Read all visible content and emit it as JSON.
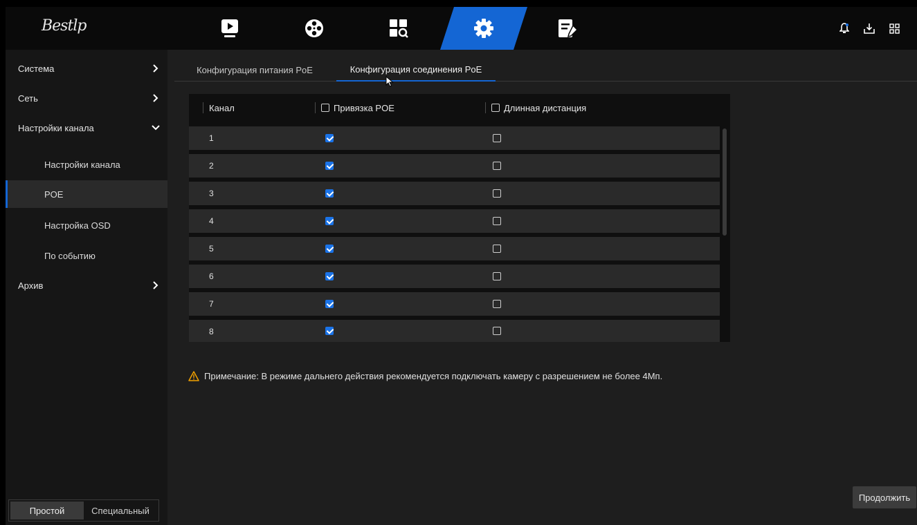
{
  "app": {
    "logo_text": "Bestlp"
  },
  "topnav": {
    "items": [
      {
        "name": "playback",
        "icon": "playback-icon"
      },
      {
        "name": "ai",
        "icon": "film-reel-icon"
      },
      {
        "name": "search",
        "icon": "search-image-icon"
      },
      {
        "name": "settings",
        "icon": "gear-icon",
        "active": true
      },
      {
        "name": "maintenance",
        "icon": "maintenance-icon"
      }
    ],
    "right_icons": [
      "alarm-bell-icon",
      "download-icon",
      "grid-icon"
    ]
  },
  "sidebar": {
    "items": [
      {
        "label": "Система",
        "arrow": "right"
      },
      {
        "label": "Сеть",
        "arrow": "right"
      },
      {
        "label": "Настройки канала",
        "arrow": "down"
      },
      {
        "label": "Настройки канала",
        "sub": true
      },
      {
        "label": "POE",
        "sub": true,
        "active": true
      },
      {
        "label": "Настройка OSD",
        "sub": true
      },
      {
        "label": "По событию",
        "sub": true
      },
      {
        "label": "Архив",
        "arrow": "right"
      }
    ],
    "mode": {
      "simple": "Простой",
      "special": "Специальный",
      "selected": "simple"
    }
  },
  "tabs": [
    {
      "label": "Конфигурация питания PoE",
      "active": false
    },
    {
      "label": "Конфигурация соединения PoE",
      "active": true
    }
  ],
  "table": {
    "headers": {
      "channel": "Канал",
      "poe_binding": "Привязка POE",
      "long_distance": "Длинная дистанция"
    },
    "rows": [
      {
        "channel": "1",
        "poe": true,
        "long": false
      },
      {
        "channel": "2",
        "poe": true,
        "long": false
      },
      {
        "channel": "3",
        "poe": true,
        "long": false
      },
      {
        "channel": "4",
        "poe": true,
        "long": false
      },
      {
        "channel": "5",
        "poe": true,
        "long": false
      },
      {
        "channel": "6",
        "poe": true,
        "long": false
      },
      {
        "channel": "7",
        "poe": true,
        "long": false
      },
      {
        "channel": "8",
        "poe": true,
        "long": false
      }
    ]
  },
  "note": "Примечание: В режиме дальнего действия рекомендуется подключать камеру с разрешением не более 4Мп.",
  "buttons": {
    "continue": "Продолжить"
  },
  "colors": {
    "accent": "#1466d4",
    "warning": "#f0a000",
    "background": "#1e1e1e",
    "topbar": "#0a0a0a"
  }
}
